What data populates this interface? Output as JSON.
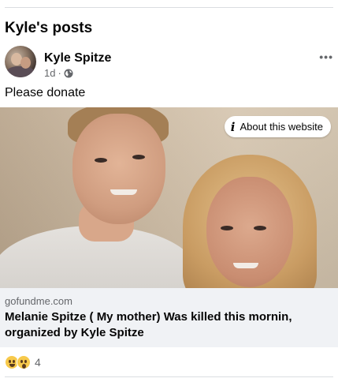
{
  "section": {
    "title": "Kyle's posts"
  },
  "post": {
    "author": "Kyle Spitze",
    "time": "1d",
    "separator": "·",
    "privacy_icon": "globe-icon",
    "more_icon": "more-horizontal-icon",
    "more_label": "•••",
    "text": "Please donate"
  },
  "link": {
    "about_label": "About this website",
    "about_icon": "info-icon",
    "domain": "gofundme.com",
    "title": "Melanie Spitze ( My mother) Was killed this mornin, organized by Kyle Spitze"
  },
  "reactions": {
    "icons": [
      "haha-emoji-icon",
      "wow-emoji-icon"
    ],
    "count": "4"
  },
  "colors": {
    "text_primary": "#050505",
    "text_secondary": "#65676b",
    "link_bg": "#f0f2f5",
    "divider": "#dadde1"
  }
}
